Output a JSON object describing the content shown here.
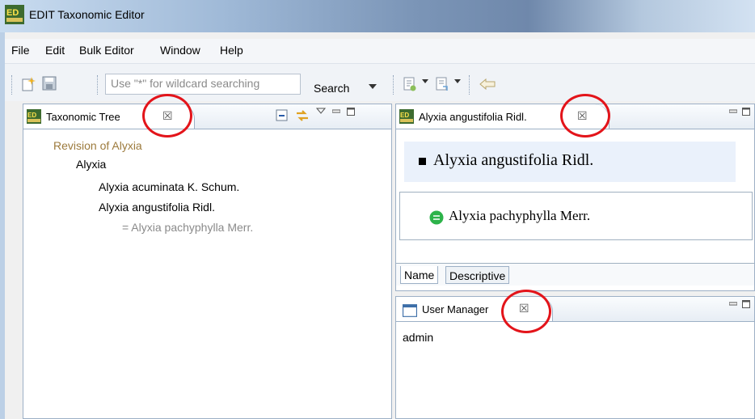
{
  "app": {
    "title": "EDIT Taxonomic Editor"
  },
  "menu": [
    "File",
    "Edit",
    "Bulk Editor",
    "Window",
    "Help"
  ],
  "search": {
    "placeholder": "Use \"*\" for wildcard searching",
    "button_label": "Search"
  },
  "taxonomic_tree": {
    "tab_label": "Taxonomic Tree",
    "items": [
      {
        "label": "Revision of Alyxia",
        "level": 0,
        "kind": "classification"
      },
      {
        "label": "Alyxia",
        "level": 1,
        "kind": "taxon"
      },
      {
        "label": "Alyxia acuminata K. Schum.",
        "level": 2,
        "kind": "taxon"
      },
      {
        "label": "Alyxia angustifolia Ridl.",
        "level": 2,
        "kind": "taxon"
      },
      {
        "label": "= Alyxia pachyphylla Merr.",
        "level": 3,
        "kind": "synonym"
      }
    ]
  },
  "editor": {
    "tab_label": "Alyxia angustifolia Ridl.",
    "accepted_name": "Alyxia angustifolia Ridl.",
    "synonym": "Alyxia pachyphylla Merr.",
    "bottom_tabs": [
      "Name",
      "Descriptive"
    ]
  },
  "user_manager": {
    "tab_label": "User Manager",
    "users": [
      "admin"
    ]
  },
  "colors": {
    "highlight": "#e3141a",
    "classification_text": "#9c7a3c",
    "synonym_text": "#8a8a8a",
    "synonym_icon": "#2db34a"
  }
}
